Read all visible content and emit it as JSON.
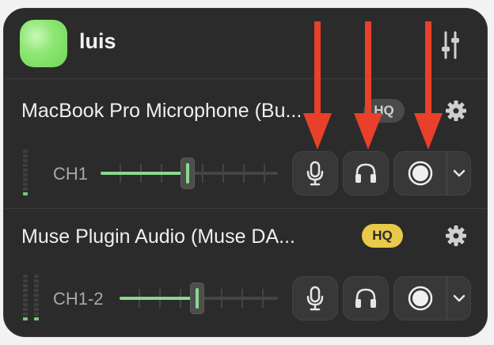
{
  "user": {
    "name": "luis"
  },
  "devices": [
    {
      "name": "MacBook Pro Microphone (Bu...",
      "hq_label": "HQ",
      "channel": "CH1",
      "volume": 0.49
    },
    {
      "name": "Muse Plugin Audio (Muse DA...",
      "hq_label": "HQ",
      "channel": "CH1-2",
      "volume": 0.49
    }
  ],
  "icons": {
    "mixer": "sliders-icon",
    "settings": "gear-icon",
    "mic": "microphone-icon",
    "monitor": "headphones-icon",
    "record": "record-icon",
    "dropdown": "chevron-down-icon"
  },
  "colors": {
    "panel": "#2b2b2b",
    "accent_green": "#8ad88c",
    "hq_active": "#e9c94a",
    "annotation_arrow": "#e8402a"
  }
}
